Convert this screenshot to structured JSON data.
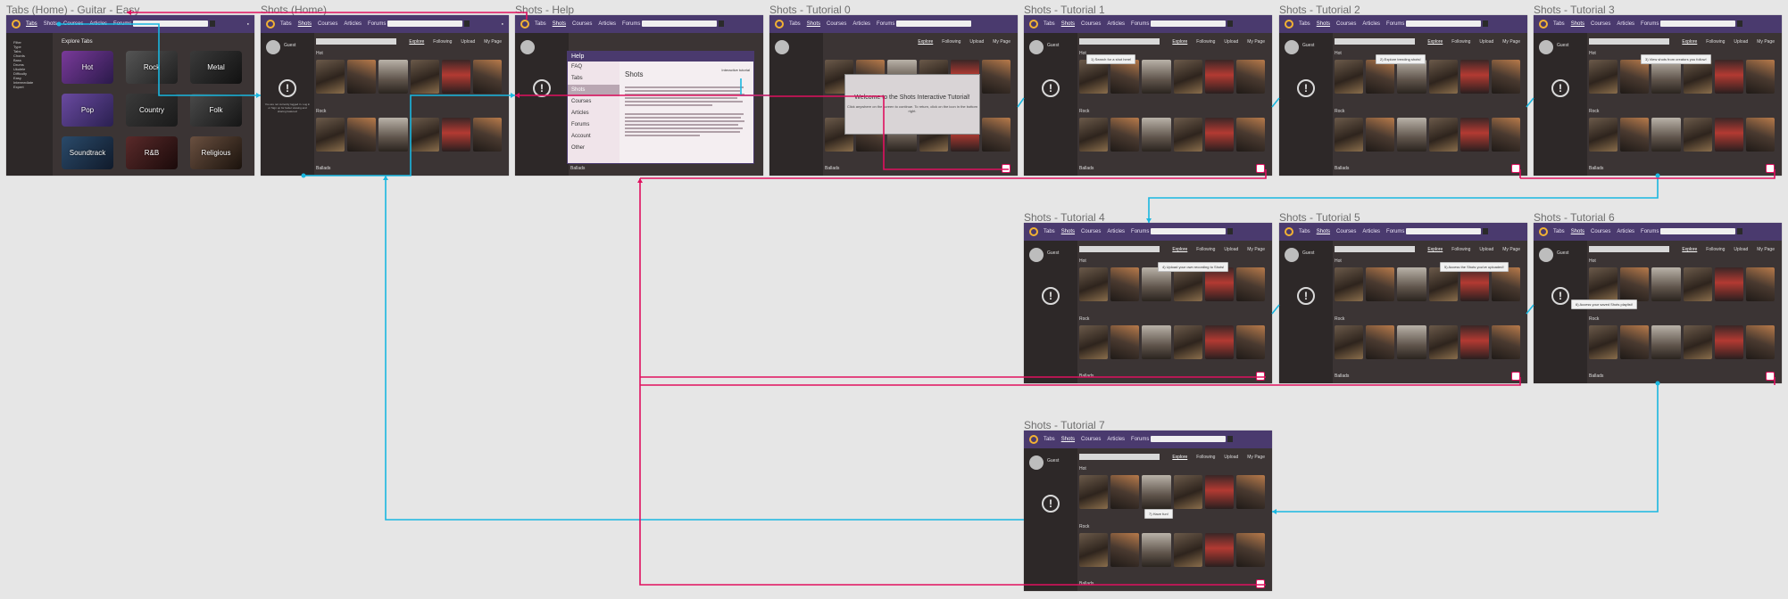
{
  "frames": {
    "tabs_home": {
      "title": "Tabs (Home) - Guitar - Easy",
      "nav": [
        "Tabs",
        "Shots",
        "Courses",
        "Articles",
        "Forums"
      ],
      "side_heading": "Filter",
      "side_items": [
        "Type",
        "Tabs",
        "Chords",
        "Bass",
        "Drums",
        "Ukulele",
        "Difficulty",
        "Easy",
        "Intermediate",
        "Expert"
      ],
      "explore_title": "Explore Tabs",
      "genres": [
        "Hot",
        "Rock",
        "Metal",
        "Pop",
        "Country",
        "Folk",
        "Soundtrack",
        "R&B",
        "Religious"
      ]
    },
    "shots_home": {
      "title": "Shots (Home)",
      "user_name": "Guest",
      "side_note": "You are not currently logged in. Log in or Sign up for better viewing and sharing features!",
      "search_placeholder": "",
      "sub_tabs": [
        "Explore",
        "Following",
        "Upload",
        "My Page"
      ],
      "rows": [
        "Hot",
        "Rock"
      ],
      "footer_row": "Ballads"
    },
    "shots_help": {
      "title": "Shots - Help",
      "dialog_title": "Help",
      "menu": [
        "FAQ",
        "Tabs",
        "Shots",
        "Courses",
        "Articles",
        "Forums",
        "Account",
        "Other"
      ],
      "heading": "Shots",
      "link": "Interactive tutorial"
    },
    "tutorial_0": {
      "title": "Shots - Tutorial 0",
      "welcome_title": "Welcome to the Shots Interactive Tutorial!",
      "welcome_sub": "Click anywhere on the screen to continue. To return, click on the icon in the bottom right."
    },
    "tutorial_1": {
      "title": "Shots - Tutorial 1",
      "tip": "1) Search for a shot here!"
    },
    "tutorial_2": {
      "title": "Shots - Tutorial 2",
      "tip": "2) Explore trending shots!"
    },
    "tutorial_3": {
      "title": "Shots - Tutorial 3",
      "tip": "3) View shots from creators you follow!"
    },
    "tutorial_4": {
      "title": "Shots - Tutorial 4",
      "tip": "4) Upload your own recording to Shots!"
    },
    "tutorial_5": {
      "title": "Shots - Tutorial 5",
      "tip": "5) Access the Shots you've uploaded!"
    },
    "tutorial_6": {
      "title": "Shots - Tutorial 6",
      "tip": "6) Access your saved Shots playlist!"
    },
    "tutorial_7": {
      "title": "Shots - Tutorial 7",
      "tip": "7) Have fun!"
    }
  },
  "colors": {
    "nav": "#4a3a6e",
    "link_cyan": "#19b7e0",
    "link_pink": "#e0105f",
    "canvas": "#e6e6e6"
  }
}
